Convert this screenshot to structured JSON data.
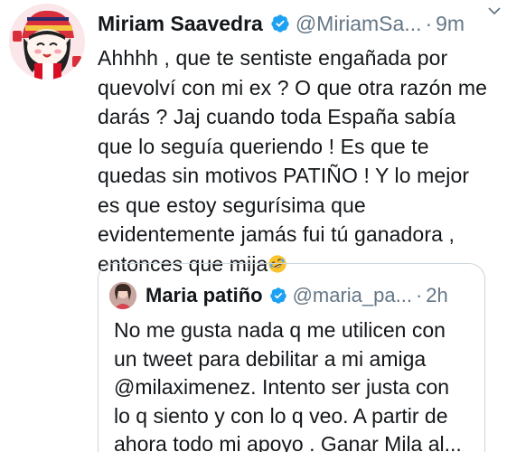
{
  "tweet": {
    "author_name": "Miriam Saavedra",
    "handle": "@MiriamSa...",
    "separator": "·",
    "time": "9m",
    "text_lines": [
      "Ahhhh , que te sentiste engañada por",
      "quevolví con mi ex ? O que otra razón me",
      "darás ? Jaj cuando toda España sabía",
      "que lo seguía queriendo ! Es que te",
      "quedas sin motivos PATIÑO ! Y lo mejor",
      "es que estoy segurísima que",
      "evidentemente jamás fui tú ganadora ,",
      "entonces que mija"
    ],
    "emoji": "rolling-on-floor-laughing"
  },
  "quoted_tweet": {
    "author_name": "Maria patiño",
    "handle": "@maria_pa...",
    "separator": "·",
    "time": "2h",
    "text_lines": [
      "No me gusta nada q me utilicen con",
      "un tweet para debilitar a mi amiga",
      "@milaximenez. Intento ser justa con",
      "lo q siento y con lo q veo. A partir de",
      "ahora todo mi apoyo . Ganar Mila al..."
    ]
  },
  "colors": {
    "verified_blue": "#1da1f2",
    "secondary_text": "#657786",
    "border": "#ccd6dd"
  },
  "icons": [
    "verified-badge-icon",
    "chevron-down-icon",
    "avatar",
    "emoji"
  ]
}
